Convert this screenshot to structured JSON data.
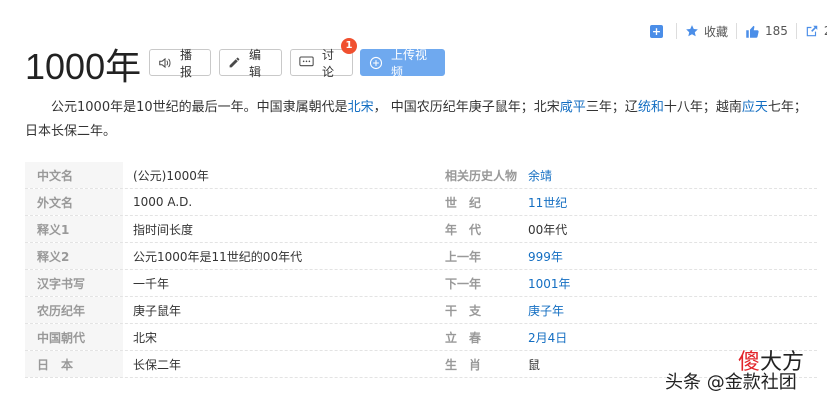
{
  "header": {
    "add_label": "+",
    "favorite_label": "收藏",
    "like_count": "185",
    "share_count": "2"
  },
  "title": "1000年",
  "buttons": {
    "play": "播报",
    "edit": "编辑",
    "discuss": "讨论",
    "discuss_badge": "1",
    "upload_video": "上传视频"
  },
  "summary": {
    "p1": "公元1000年是10世纪的最后一年。中国隶属朝代是",
    "l1": "北宋",
    "p2": "， 中国农历纪年庚子鼠年；北宋",
    "l2": "咸平",
    "p3": "三年；辽",
    "l3": "统和",
    "p4": "十八年；越南",
    "l4": "应天",
    "p5": "七年；日本长保二年。"
  },
  "infobox": [
    {
      "k1": "中文名",
      "v1": "(公元)1000年",
      "k2": "相关历史人物",
      "v2": "余靖"
    },
    {
      "k1": "外文名",
      "v1": "1000 A.D.",
      "k2": "世　纪",
      "v2": "11世纪"
    },
    {
      "k1": "释义1",
      "v1": "指时间长度",
      "k2": "年　代",
      "v2": "00年代"
    },
    {
      "k1": "释义2",
      "v1": "公元1000年是11世纪的00年代",
      "k2": "上一年",
      "v2": "999年"
    },
    {
      "k1": "汉字书写",
      "v1": "一千年",
      "k2": "下一年",
      "v2": "1001年"
    },
    {
      "k1": "农历纪年",
      "v1": "庚子鼠年",
      "k2": "干　支",
      "v2": "庚子年"
    },
    {
      "k1": "中国朝代",
      "v1": "北宋",
      "k2": "立　春",
      "v2": "2月4日"
    },
    {
      "k1": "日　本",
      "v1": "长保二年",
      "k2": "生　肖",
      "v2": "鼠"
    }
  ],
  "watermark": {
    "logo_red": "傻",
    "logo_rest": "大方",
    "text": "头条 @金款社团"
  },
  "colors": {
    "link": "#136ec2",
    "primary_button": "#6fa9ef",
    "badge": "#f0502f"
  }
}
